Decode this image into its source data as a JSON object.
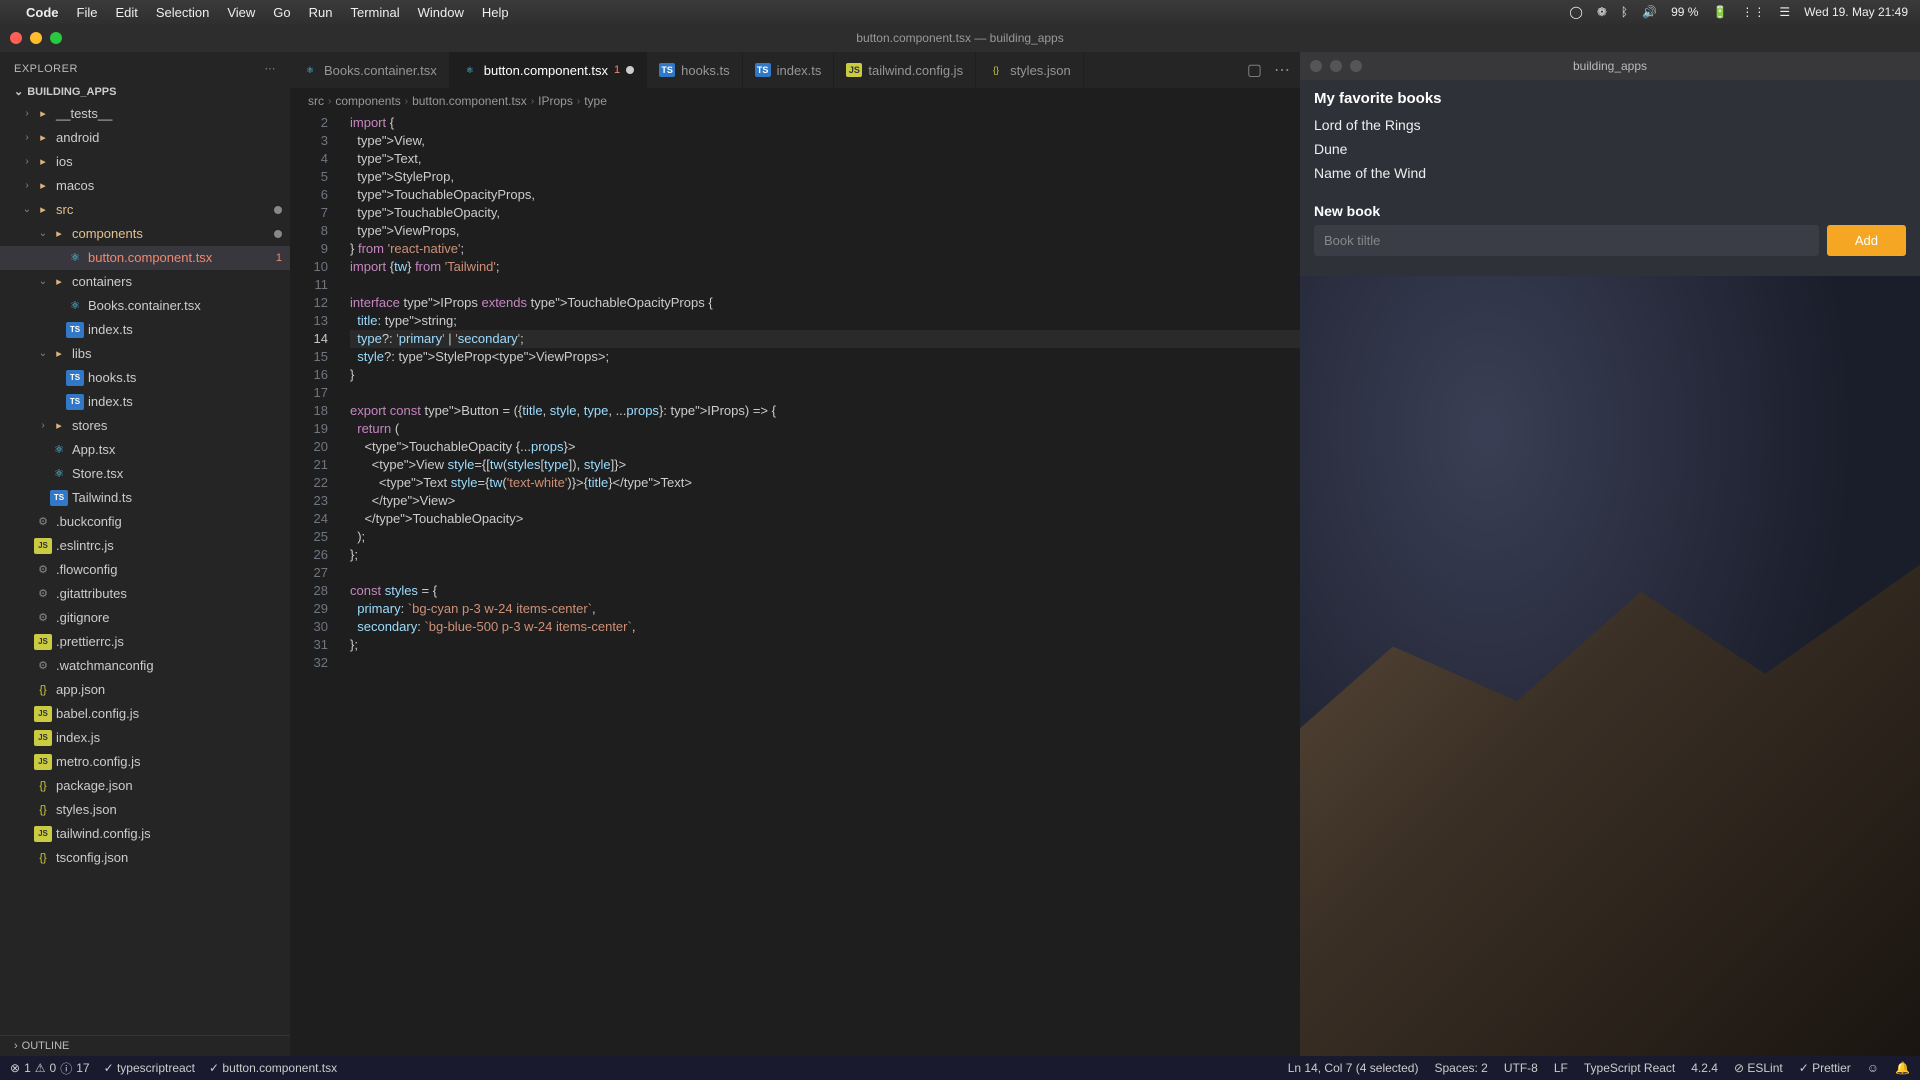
{
  "menubar": {
    "app": "Code",
    "items": [
      "File",
      "Edit",
      "Selection",
      "View",
      "Go",
      "Run",
      "Terminal",
      "Window",
      "Help"
    ],
    "battery": "99 %",
    "datetime": "Wed 19. May  21:49"
  },
  "window": {
    "title": "button.component.tsx — building_apps"
  },
  "sidebar": {
    "header": "Explorer",
    "project": "BUILDING_APPS",
    "outline": "Outline",
    "tree": [
      {
        "label": "__tests__",
        "icon": "folder",
        "indent": 1,
        "chev": "›"
      },
      {
        "label": "android",
        "icon": "folder",
        "indent": 1,
        "chev": "›"
      },
      {
        "label": "ios",
        "icon": "folder",
        "indent": 1,
        "chev": "›"
      },
      {
        "label": "macos",
        "icon": "folder",
        "indent": 1,
        "chev": "›"
      },
      {
        "label": "src",
        "icon": "folder",
        "indent": 1,
        "chev": "⌄",
        "modified": true
      },
      {
        "label": "components",
        "icon": "folder",
        "indent": 2,
        "chev": "⌄",
        "modified": true
      },
      {
        "label": "button.component.tsx",
        "icon": "react",
        "indent": 3,
        "active": true,
        "error": true,
        "badge": "1"
      },
      {
        "label": "containers",
        "icon": "folder",
        "indent": 2,
        "chev": "⌄"
      },
      {
        "label": "Books.container.tsx",
        "icon": "react",
        "indent": 3
      },
      {
        "label": "index.ts",
        "icon": "ts",
        "indent": 3
      },
      {
        "label": "libs",
        "icon": "folder",
        "indent": 2,
        "chev": "⌄"
      },
      {
        "label": "hooks.ts",
        "icon": "ts",
        "indent": 3
      },
      {
        "label": "index.ts",
        "icon": "ts",
        "indent": 3
      },
      {
        "label": "stores",
        "icon": "folder",
        "indent": 2,
        "chev": "›"
      },
      {
        "label": "App.tsx",
        "icon": "react",
        "indent": 2
      },
      {
        "label": "Store.tsx",
        "icon": "react",
        "indent": 2
      },
      {
        "label": "Tailwind.ts",
        "icon": "ts",
        "indent": 2
      },
      {
        "label": ".buckconfig",
        "icon": "config",
        "indent": 1
      },
      {
        "label": ".eslintrc.js",
        "icon": "js",
        "indent": 1
      },
      {
        "label": ".flowconfig",
        "icon": "config",
        "indent": 1
      },
      {
        "label": ".gitattributes",
        "icon": "config",
        "indent": 1
      },
      {
        "label": ".gitignore",
        "icon": "config",
        "indent": 1
      },
      {
        "label": ".prettierrc.js",
        "icon": "js",
        "indent": 1
      },
      {
        "label": ".watchmanconfig",
        "icon": "config",
        "indent": 1
      },
      {
        "label": "app.json",
        "icon": "json",
        "indent": 1
      },
      {
        "label": "babel.config.js",
        "icon": "js",
        "indent": 1
      },
      {
        "label": "index.js",
        "icon": "js",
        "indent": 1
      },
      {
        "label": "metro.config.js",
        "icon": "js",
        "indent": 1
      },
      {
        "label": "package.json",
        "icon": "json",
        "indent": 1
      },
      {
        "label": "styles.json",
        "icon": "json",
        "indent": 1
      },
      {
        "label": "tailwind.config.js",
        "icon": "js",
        "indent": 1
      },
      {
        "label": "tsconfig.json",
        "icon": "json",
        "indent": 1
      }
    ]
  },
  "tabs": [
    {
      "label": "Books.container.tsx",
      "icon": "react"
    },
    {
      "label": "button.component.tsx",
      "icon": "react",
      "active": true,
      "err": "1",
      "modified": true
    },
    {
      "label": "hooks.ts",
      "icon": "ts"
    },
    {
      "label": "index.ts",
      "icon": "ts"
    },
    {
      "label": "tailwind.config.js",
      "icon": "js"
    },
    {
      "label": "styles.json",
      "icon": "json"
    }
  ],
  "breadcrumb": [
    "src",
    "components",
    "button.component.tsx",
    "IProps",
    "type"
  ],
  "code": {
    "start": 2,
    "current": 14,
    "lines": [
      "import {",
      "  View,",
      "  Text,",
      "  StyleProp,",
      "  TouchableOpacityProps,",
      "  TouchableOpacity,",
      "  ViewProps,",
      "} from 'react-native';",
      "import {tw} from 'Tailwind';",
      "",
      "interface IProps extends TouchableOpacityProps {",
      "  title: string;",
      "  type?: 'primary' | 'secondary';",
      "  style?: StyleProp<ViewProps>;",
      "}",
      "",
      "export const Button = ({title, style, type, ...props}: IProps) => {",
      "  return (",
      "    <TouchableOpacity {...props}>",
      "      <View style={[tw(styles[type]), style]}>",
      "        <Text style={tw('text-white')}>{title}</Text>",
      "      </View>",
      "    </TouchableOpacity>",
      "  );",
      "};",
      "",
      "const styles = {",
      "  primary: `bg-cyan p-3 w-24 items-center`,",
      "  secondary: `bg-blue-500 p-3 w-24 items-center`,",
      "};",
      ""
    ]
  },
  "simulator": {
    "title": "building_apps",
    "heading": "My favorite books",
    "items": [
      "Lord of the Rings",
      "Dune",
      "Name of the Wind"
    ],
    "newbook": "New book",
    "placeholder": "Book tiltle",
    "button": "Add"
  },
  "statusbar": {
    "errors": "1",
    "warnings": "0",
    "info": "17",
    "lang_check": "typescriptreact",
    "file_check": "button.component.tsx",
    "cursor": "Ln 14, Col 7 (4 selected)",
    "spaces": "Spaces: 2",
    "encoding": "UTF-8",
    "eol": "LF",
    "lang": "TypeScript React",
    "version": "4.2.4",
    "eslint": "ESLint",
    "prettier": "Prettier"
  }
}
